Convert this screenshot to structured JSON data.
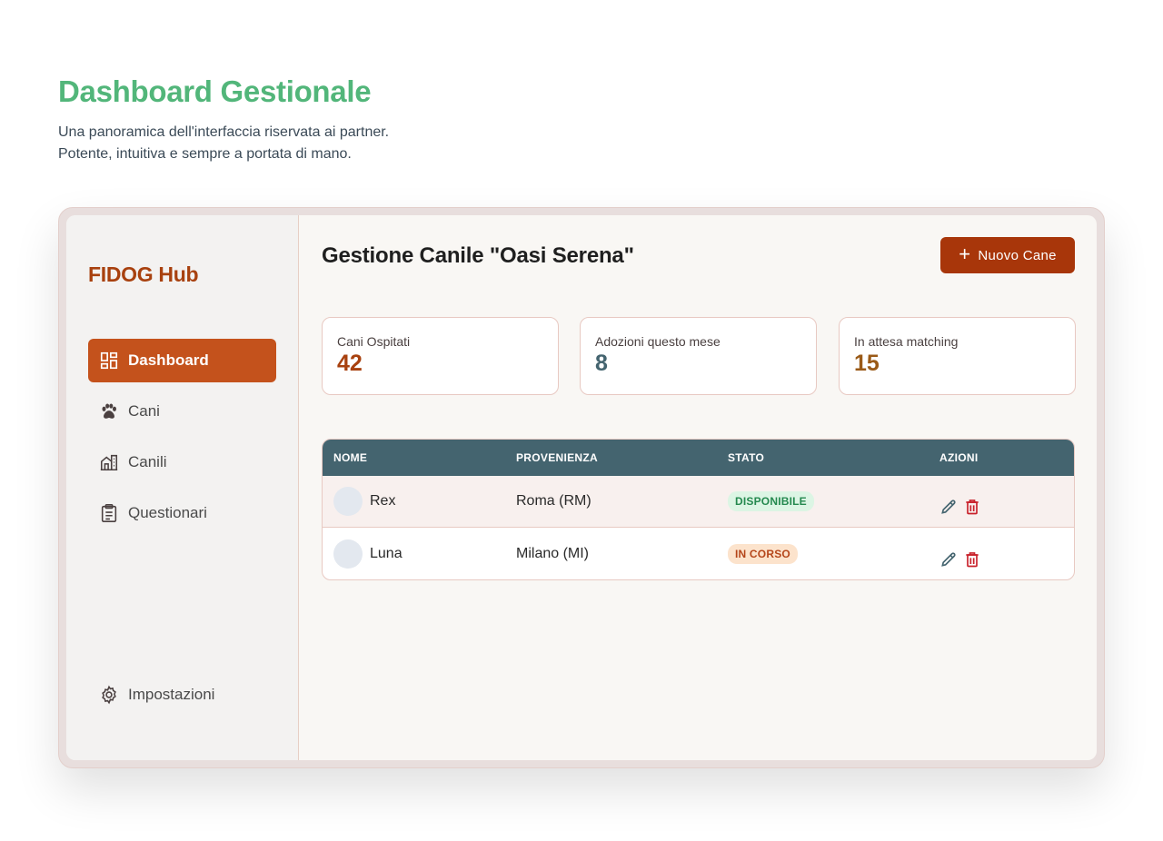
{
  "hero": {
    "title": "Dashboard Gestionale",
    "subtitle_line1": "Una panoramica dell'interfaccia riservata ai partner.",
    "subtitle_line2": "Potente, intuitiva e sempre a portata di mano."
  },
  "sidebar": {
    "brand": "FIDOG Hub",
    "items": [
      {
        "label": "Dashboard",
        "icon": "dashboard-icon",
        "active": true
      },
      {
        "label": "Cani",
        "icon": "paw-icon",
        "active": false
      },
      {
        "label": "Canili",
        "icon": "building-icon",
        "active": false
      },
      {
        "label": "Questionari",
        "icon": "clipboard-icon",
        "active": false
      }
    ],
    "settings": {
      "label": "Impostazioni",
      "icon": "gear-icon"
    }
  },
  "main": {
    "title": "Gestione Canile \"Oasi Serena\"",
    "new_button": "Nuovo Cane",
    "stats": [
      {
        "label": "Cani Ospitati",
        "value": "42",
        "color": "#a8410f"
      },
      {
        "label": "Adozioni questo mese",
        "value": "8",
        "color": "#44646f"
      },
      {
        "label": "In attesa matching",
        "value": "15",
        "color": "#9a5a17"
      }
    ],
    "table": {
      "headers": [
        "NOME",
        "PROVENIENZA",
        "STATO",
        "AZIONI"
      ],
      "rows": [
        {
          "name": "Rex",
          "origin": "Roma (RM)",
          "status": "DISPONIBILE",
          "status_type": "ok"
        },
        {
          "name": "Luna",
          "origin": "Milano (MI)",
          "status": "IN CORSO",
          "status_type": "wip"
        }
      ]
    }
  },
  "colors": {
    "accent_green": "#52b67a",
    "brand": "#a8410f",
    "primary_button": "#a8360a",
    "active_nav": "#c4521c",
    "table_header": "#44646f"
  }
}
